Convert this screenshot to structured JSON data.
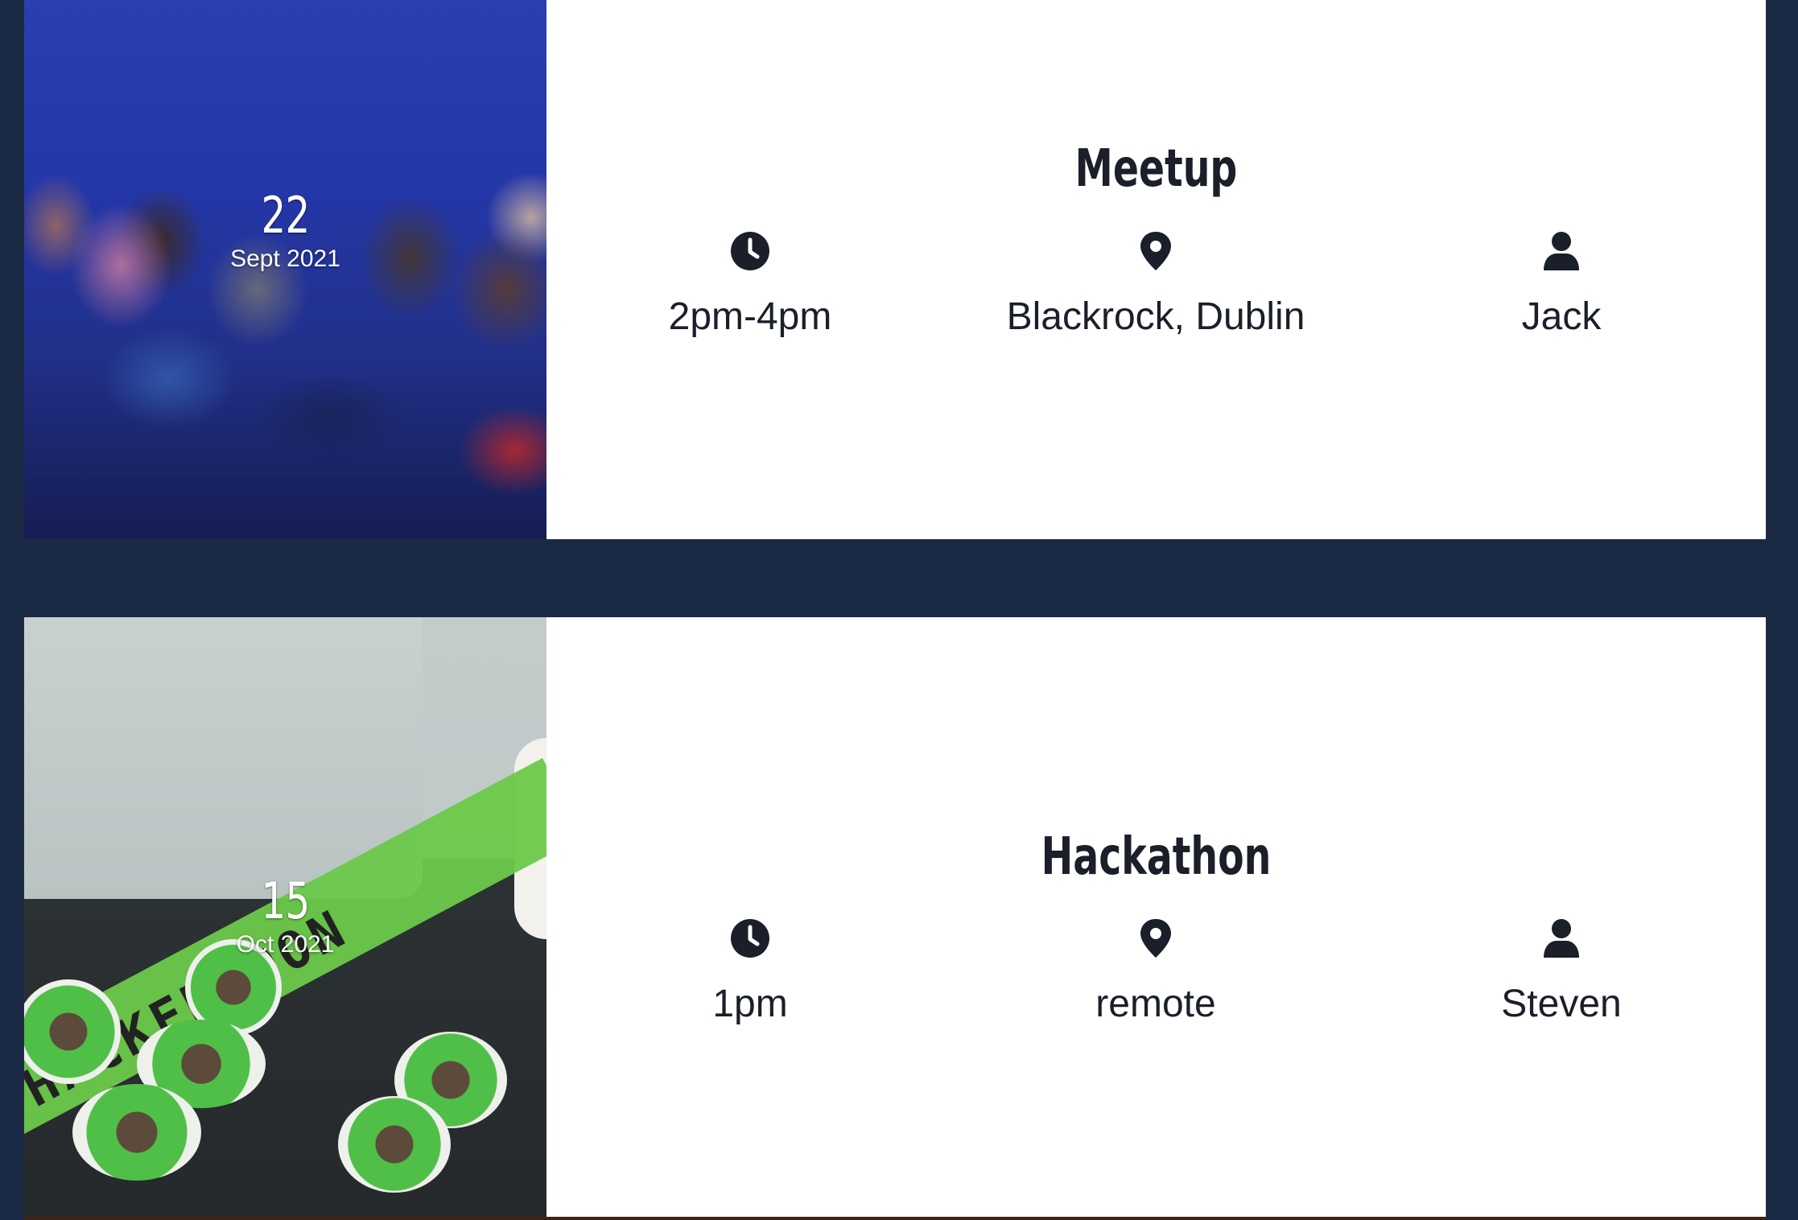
{
  "events": [
    {
      "day": "22",
      "month_year": "Sept 2021",
      "title": "Meetup",
      "time": "2pm-4pm",
      "location": "Blackrock, Dublin",
      "host": "Jack"
    },
    {
      "day": "15",
      "month_year": "Oct 2021",
      "title": "Hackathon",
      "time": "1pm",
      "location": "remote",
      "host": "Steven"
    }
  ],
  "hackathon_image_text": "HACKERNOON",
  "icons": {
    "time": "clock-icon",
    "location": "map-pin-icon",
    "host": "user-icon"
  },
  "colors": {
    "page_background": "#1b2a44",
    "card_background": "#ffffff",
    "text": "#1b1f2a"
  }
}
